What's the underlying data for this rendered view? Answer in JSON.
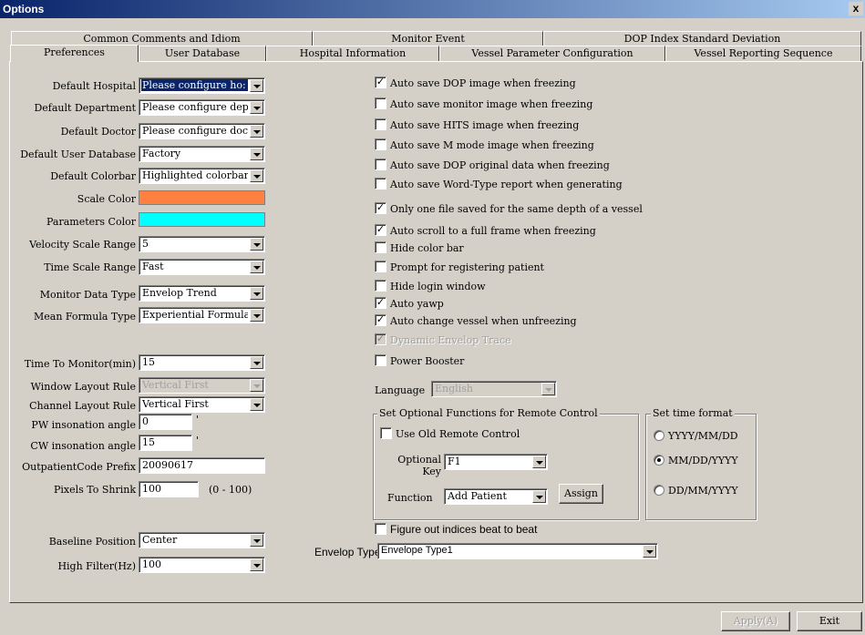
{
  "window": {
    "title": "Options",
    "close_label": "x"
  },
  "tabs": {
    "row1": [
      "Common Comments and Idiom",
      "Monitor Event",
      "DOP Index Standard Deviation"
    ],
    "row2": [
      "Preferences",
      "User Database",
      "Hospital Information",
      "Vessel Parameter Configuration",
      "Vessel Reporting Sequence"
    ]
  },
  "left": {
    "default_hospital": {
      "label": "Default Hospital",
      "value": "Please configure ho:"
    },
    "default_department": {
      "label": "Default Department",
      "value": "Please configure dep"
    },
    "default_doctor": {
      "label": "Default Doctor",
      "value": "Please configure doc"
    },
    "default_user_database": {
      "label": "Default User Database",
      "value": "Factory"
    },
    "default_colorbar": {
      "label": "Default Colorbar",
      "value": "Highlighted colorbar"
    },
    "scale_color": {
      "label": "Scale Color",
      "color": "#ff8040"
    },
    "parameters_color": {
      "label": "Parameters Color",
      "color": "#00ffff"
    },
    "velocity_scale_range": {
      "label": "Velocity Scale Range",
      "value": "5"
    },
    "time_scale_range": {
      "label": "Time Scale Range",
      "value": "Fast"
    },
    "monitor_data_type": {
      "label": "Monitor Data Type",
      "value": "Envelop Trend"
    },
    "mean_formula_type": {
      "label": "Mean Formula Type",
      "value": "Experiential Formula"
    },
    "time_to_monitor": {
      "label": "Time To Monitor(min)",
      "value": "15"
    },
    "window_layout_rule": {
      "label": "Window Layout Rule",
      "value": "Vertical First"
    },
    "channel_layout_rule": {
      "label": "Channel Layout Rule",
      "value": "Vertical First"
    },
    "pw_angle": {
      "label": "PW insonation angle",
      "value": "0",
      "unit": "'"
    },
    "cw_angle": {
      "label": "CW insonation angle",
      "value": "15",
      "unit": "'"
    },
    "outpatient_prefix": {
      "label": "OutpatientCode Prefix",
      "value": "20090617"
    },
    "pixels_to_shrink": {
      "label": "Pixels To Shrink",
      "value": "100",
      "range": "(0 - 100)"
    },
    "baseline_position": {
      "label": "Baseline Position",
      "value": "Center"
    },
    "high_filter": {
      "label": "High Filter(Hz)",
      "value": "100"
    }
  },
  "checks": [
    {
      "label": "Auto save DOP image when freezing",
      "checked": true
    },
    {
      "label": "Auto save monitor image when freezing",
      "checked": false
    },
    {
      "label": "Auto save HITS image when freezing",
      "checked": false
    },
    {
      "label": "Auto save M mode image when freezing",
      "checked": false
    },
    {
      "label": "Auto save DOP original data when freezing",
      "checked": false
    },
    {
      "label": "Auto save Word-Type report when generating",
      "checked": false
    },
    {
      "label": "Only one file saved for the same depth of a vessel",
      "checked": true
    },
    {
      "label": "Auto scroll to a full frame when freezing",
      "checked": true
    },
    {
      "label": "Hide color bar",
      "checked": false
    },
    {
      "label": "Prompt for registering patient",
      "checked": false
    },
    {
      "label": "Hide login window",
      "checked": false
    },
    {
      "label": "Auto yawp",
      "checked": true
    },
    {
      "label": "Auto change vessel when unfreezing",
      "checked": true
    },
    {
      "label": "Dynamic Envelop Trace",
      "checked": true,
      "disabled": true
    },
    {
      "label": "Power Booster",
      "checked": false
    }
  ],
  "language": {
    "label": "Language",
    "value": "English"
  },
  "remote": {
    "title": "Set Optional Functions for Remote Control",
    "use_old_label": "Use Old Remote Control",
    "optional_key_label": "Optional Key",
    "optional_key_value": "F1",
    "function_label": "Function",
    "function_value": "Add Patient",
    "assign_label": "Assign"
  },
  "time_format": {
    "title": "Set time format",
    "options": [
      "YYYY/MM/DD",
      "MM/DD/YYYY",
      "DD/MM/YYYY"
    ],
    "selected": 1
  },
  "beat": {
    "label": "Figure out indices beat to beat",
    "checked": false
  },
  "envelop": {
    "label": "Envelop Type",
    "value": "Envelope Type1"
  },
  "buttons": {
    "apply": "Apply(A)",
    "exit": "Exit"
  }
}
